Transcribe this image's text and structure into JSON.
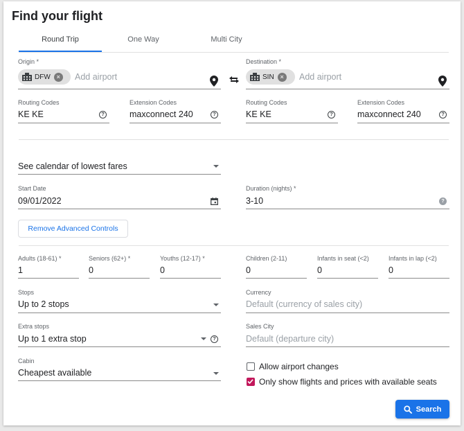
{
  "title": "Find your flight",
  "tabs": [
    {
      "label": "Round Trip",
      "active": true
    },
    {
      "label": "One Way",
      "active": false
    },
    {
      "label": "Multi City",
      "active": false
    }
  ],
  "origin": {
    "label": "Origin *",
    "chip": "DFW",
    "placeholder": "Add airport"
  },
  "destination": {
    "label": "Destination *",
    "chip": "SIN",
    "placeholder": "Add airport"
  },
  "origin_codes": {
    "routing_label": "Routing Codes",
    "routing_value": "KE KE",
    "extension_label": "Extension Codes",
    "extension_value": "maxconnect 240"
  },
  "destination_codes": {
    "routing_label": "Routing Codes",
    "routing_value": "KE KE",
    "extension_label": "Extension Codes",
    "extension_value": "maxconnect 240"
  },
  "calendar_select": "See calendar of lowest fares",
  "start_date": {
    "label": "Start Date",
    "value": "09/01/2022"
  },
  "duration": {
    "label": "Duration (nights) *",
    "value": "3-10"
  },
  "advanced_button": "Remove Advanced Controls",
  "passengers": [
    {
      "label": "Adults (18-61) *",
      "value": "1"
    },
    {
      "label": "Seniors (62+) *",
      "value": "0"
    },
    {
      "label": "Youths (12-17) *",
      "value": "0"
    },
    {
      "label": "Children (2-11)",
      "value": "0"
    },
    {
      "label": "Infants in seat (<2)",
      "value": "0"
    },
    {
      "label": "Infants in lap (<2)",
      "value": "0"
    }
  ],
  "stops": {
    "label": "Stops",
    "value": "Up to 2 stops"
  },
  "currency": {
    "label": "Currency",
    "placeholder": "Default (currency of sales city)"
  },
  "extra_stops": {
    "label": "Extra stops",
    "value": "Up to 1 extra stop"
  },
  "sales_city": {
    "label": "Sales City",
    "placeholder": "Default (departure city)"
  },
  "cabin": {
    "label": "Cabin",
    "value": "Cheapest available"
  },
  "checkboxes": [
    {
      "label": "Allow airport changes",
      "checked": false
    },
    {
      "label": "Only show flights and prices with available seats",
      "checked": true
    }
  ],
  "search_button": "Search",
  "colors": {
    "accent": "#1a73e8",
    "checkbox_checked": "#c2185b"
  }
}
